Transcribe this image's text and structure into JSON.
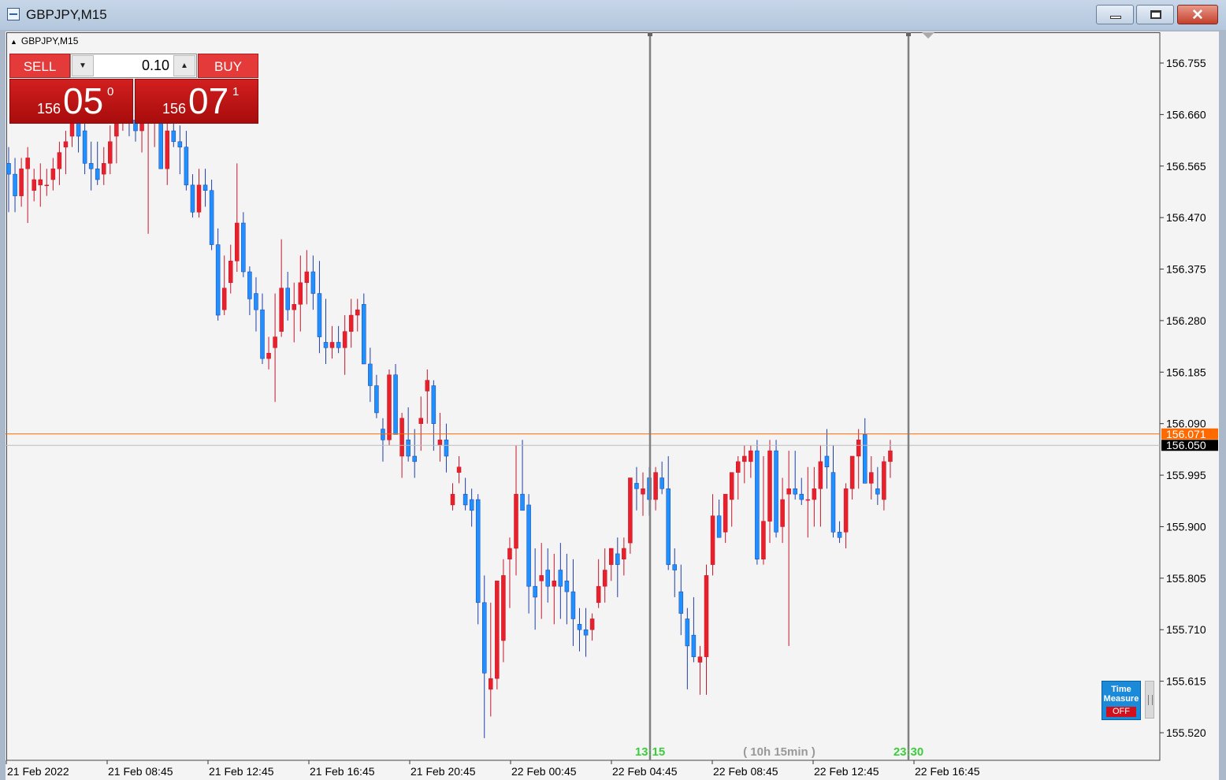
{
  "window": {
    "title": "GBPJPY,M15"
  },
  "chart": {
    "symbol_label": "GBPJPY,M15"
  },
  "trade_panel": {
    "sell_label": "SELL",
    "buy_label": "BUY",
    "lot": "0.10",
    "sell_price": {
      "prefix": "156",
      "big": "05",
      "sup": "0"
    },
    "buy_price": {
      "prefix": "156",
      "big": "07",
      "sup": "1"
    }
  },
  "time_measure": {
    "line1": "Time",
    "line2": "Measure",
    "state": "OFF"
  },
  "colors": {
    "background": "#f4f4f4",
    "bull_candle": "#e8202a",
    "bear_candle": "#1e90ff",
    "bid_line": "#ff6a00",
    "ask_line": "#bbbbbb",
    "marker_line": "#808080",
    "marker_text": "#3ccd3c"
  },
  "chart_data": {
    "type": "candlestick",
    "price_axis_ticks": [
      "156.755",
      "156.660",
      "156.565",
      "156.470",
      "156.375",
      "156.280",
      "156.185",
      "156.090",
      "155.995",
      "155.900",
      "155.805",
      "155.710",
      "155.615",
      "155.520"
    ],
    "time_axis_ticks": [
      "21 Feb 2022",
      "21 Feb 08:45",
      "21 Feb 12:45",
      "21 Feb 16:45",
      "21 Feb 20:45",
      "22 Feb 00:45",
      "22 Feb 04:45",
      "22 Feb 08:45",
      "22 Feb 12:45",
      "22 Feb 16:45"
    ],
    "bid_price": "156.050",
    "ask_price": "156.071",
    "markers": [
      {
        "label": "13:15"
      },
      {
        "label": "23:30"
      }
    ],
    "interval_label": "( 10h 15min )",
    "candles": [
      [
        156.57,
        156.6,
        156.48,
        156.55
      ],
      [
        156.55,
        156.58,
        156.48,
        156.51
      ],
      [
        156.51,
        156.58,
        156.49,
        156.56
      ],
      [
        156.56,
        156.6,
        156.46,
        156.58
      ],
      [
        156.52,
        156.56,
        156.5,
        156.54
      ],
      [
        156.53,
        156.57,
        156.49,
        156.54
      ],
      [
        156.53,
        156.56,
        156.51,
        156.53
      ],
      [
        156.54,
        156.58,
        156.52,
        156.56
      ],
      [
        156.56,
        156.61,
        156.53,
        156.59
      ],
      [
        156.6,
        156.63,
        156.55,
        156.61
      ],
      [
        156.62,
        156.7,
        156.6,
        156.66
      ],
      [
        156.66,
        156.7,
        156.59,
        156.62
      ],
      [
        156.63,
        156.66,
        156.55,
        156.57
      ],
      [
        156.57,
        156.61,
        156.52,
        156.56
      ],
      [
        156.56,
        156.61,
        156.53,
        156.54
      ],
      [
        156.55,
        156.6,
        156.53,
        156.57
      ],
      [
        156.57,
        156.64,
        156.55,
        156.61
      ],
      [
        156.62,
        156.7,
        156.57,
        156.66
      ],
      [
        156.66,
        156.71,
        156.63,
        156.68
      ],
      [
        156.67,
        156.72,
        156.62,
        156.66
      ],
      [
        156.65,
        156.71,
        156.61,
        156.63
      ],
      [
        156.63,
        156.67,
        156.59,
        156.65
      ],
      [
        156.65,
        156.71,
        156.44,
        156.66
      ],
      [
        156.66,
        156.71,
        156.6,
        156.69
      ],
      [
        156.68,
        156.72,
        156.57,
        156.56
      ],
      [
        156.56,
        156.67,
        156.53,
        156.63
      ],
      [
        156.63,
        156.67,
        156.6,
        156.61
      ],
      [
        156.61,
        156.64,
        156.55,
        156.6
      ],
      [
        156.6,
        156.63,
        156.52,
        156.53
      ],
      [
        156.53,
        156.55,
        156.47,
        156.48
      ],
      [
        156.48,
        156.56,
        156.47,
        156.53
      ],
      [
        156.53,
        156.56,
        156.49,
        156.52
      ],
      [
        156.52,
        156.54,
        156.41,
        156.42
      ],
      [
        156.42,
        156.45,
        156.28,
        156.29
      ],
      [
        156.3,
        156.4,
        156.29,
        156.34
      ],
      [
        156.35,
        156.42,
        156.33,
        156.39
      ],
      [
        156.39,
        156.57,
        156.37,
        156.46
      ],
      [
        156.46,
        156.48,
        156.36,
        156.37
      ],
      [
        156.37,
        156.38,
        156.29,
        156.32
      ],
      [
        156.33,
        156.36,
        156.26,
        156.3
      ],
      [
        156.3,
        156.33,
        156.2,
        156.21
      ],
      [
        156.21,
        156.25,
        156.19,
        156.22
      ],
      [
        156.23,
        156.33,
        156.13,
        156.25
      ],
      [
        156.26,
        156.43,
        156.25,
        156.34
      ],
      [
        156.34,
        156.37,
        156.28,
        156.3
      ],
      [
        156.3,
        156.35,
        156.24,
        156.31
      ],
      [
        156.31,
        156.4,
        156.26,
        156.35
      ],
      [
        156.35,
        156.41,
        156.31,
        156.37
      ],
      [
        156.37,
        156.4,
        156.3,
        156.33
      ],
      [
        156.33,
        156.39,
        156.22,
        156.25
      ],
      [
        156.24,
        156.32,
        156.2,
        156.23
      ],
      [
        156.23,
        156.27,
        156.21,
        156.24
      ],
      [
        156.24,
        156.27,
        156.22,
        156.23
      ],
      [
        156.23,
        156.29,
        156.18,
        156.26
      ],
      [
        156.26,
        156.32,
        156.23,
        156.29
      ],
      [
        156.29,
        156.32,
        156.26,
        156.3
      ],
      [
        156.31,
        156.33,
        156.2,
        156.2
      ],
      [
        156.2,
        156.23,
        156.13,
        156.16
      ],
      [
        156.16,
        156.18,
        156.1,
        156.11
      ],
      [
        156.08,
        156.1,
        156.02,
        156.06
      ],
      [
        156.06,
        156.19,
        156.05,
        156.18
      ],
      [
        156.18,
        156.2,
        156.07,
        156.07
      ],
      [
        156.03,
        156.11,
        155.99,
        156.1
      ],
      [
        156.06,
        156.12,
        156.02,
        156.03
      ],
      [
        156.03,
        156.08,
        155.99,
        156.02
      ],
      [
        156.09,
        156.14,
        156.04,
        156.1
      ],
      [
        156.15,
        156.19,
        156.09,
        156.17
      ],
      [
        156.16,
        156.17,
        156.04,
        156.09
      ],
      [
        156.05,
        156.11,
        156.02,
        156.06
      ],
      [
        156.06,
        156.09,
        156.0,
        156.03
      ],
      [
        155.94,
        155.98,
        155.93,
        155.96
      ],
      [
        156.0,
        156.03,
        155.98,
        156.01
      ],
      [
        155.96,
        155.99,
        155.93,
        155.94
      ],
      [
        155.95,
        155.97,
        155.9,
        155.93
      ],
      [
        155.95,
        155.96,
        155.72,
        155.76
      ],
      [
        155.76,
        155.81,
        155.51,
        155.63
      ],
      [
        155.6,
        155.76,
        155.55,
        155.62
      ],
      [
        155.62,
        155.79,
        155.6,
        155.8
      ],
      [
        155.69,
        155.84,
        155.65,
        155.81
      ],
      [
        155.84,
        155.88,
        155.75,
        155.86
      ],
      [
        155.86,
        156.05,
        155.81,
        155.96
      ],
      [
        155.96,
        156.06,
        155.94,
        155.93
      ],
      [
        155.94,
        155.96,
        155.74,
        155.79
      ],
      [
        155.79,
        155.86,
        155.71,
        155.77
      ],
      [
        155.8,
        155.87,
        155.73,
        155.81
      ],
      [
        155.82,
        155.86,
        155.76,
        155.79
      ],
      [
        155.79,
        155.85,
        155.72,
        155.8
      ],
      [
        155.82,
        155.87,
        155.73,
        155.79
      ],
      [
        155.8,
        155.85,
        155.72,
        155.78
      ],
      [
        155.78,
        155.84,
        155.68,
        155.73
      ],
      [
        155.72,
        155.75,
        155.67,
        155.71
      ],
      [
        155.71,
        155.75,
        155.66,
        155.7
      ],
      [
        155.71,
        155.74,
        155.69,
        155.73
      ],
      [
        155.76,
        155.84,
        155.75,
        155.79
      ],
      [
        155.79,
        155.86,
        155.76,
        155.82
      ],
      [
        155.83,
        155.86,
        155.8,
        155.86
      ],
      [
        155.85,
        155.88,
        155.77,
        155.83
      ],
      [
        155.84,
        155.88,
        155.81,
        155.86
      ],
      [
        155.87,
        155.99,
        155.85,
        155.99
      ],
      [
        155.98,
        156.01,
        155.93,
        155.97
      ],
      [
        155.96,
        156.0,
        155.92,
        155.97
      ],
      [
        155.99,
        156.01,
        155.92,
        155.95
      ],
      [
        155.95,
        156.01,
        155.93,
        156.0
      ],
      [
        155.99,
        156.02,
        155.96,
        155.97
      ],
      [
        155.97,
        156.03,
        155.82,
        155.83
      ],
      [
        155.83,
        155.86,
        155.77,
        155.82
      ],
      [
        155.78,
        155.83,
        155.7,
        155.74
      ],
      [
        155.73,
        155.75,
        155.6,
        155.68
      ],
      [
        155.7,
        155.77,
        155.65,
        155.66
      ],
      [
        155.65,
        155.68,
        155.59,
        155.66
      ],
      [
        155.66,
        155.83,
        155.59,
        155.81
      ],
      [
        155.83,
        155.96,
        155.81,
        155.92
      ],
      [
        155.92,
        155.95,
        155.88,
        155.88
      ],
      [
        155.89,
        155.96,
        155.87,
        155.96
      ],
      [
        155.95,
        155.99,
        155.9,
        156.0
      ],
      [
        156.0,
        156.03,
        155.95,
        156.02
      ],
      [
        156.02,
        156.05,
        155.98,
        156.03
      ],
      [
        156.02,
        156.05,
        155.99,
        156.04
      ],
      [
        156.04,
        156.06,
        155.83,
        155.84
      ],
      [
        155.84,
        156.03,
        155.83,
        155.91
      ],
      [
        155.91,
        156.06,
        155.87,
        156.04
      ],
      [
        156.04,
        156.06,
        155.88,
        155.89
      ],
      [
        155.9,
        155.99,
        155.87,
        155.95
      ],
      [
        155.96,
        156.04,
        155.68,
        155.97
      ],
      [
        155.97,
        156.04,
        155.95,
        155.96
      ],
      [
        155.96,
        155.99,
        155.94,
        155.95
      ],
      [
        155.95,
        156.01,
        155.88,
        155.95
      ],
      [
        155.95,
        156.01,
        155.9,
        155.97
      ],
      [
        155.97,
        156.05,
        155.9,
        156.02
      ],
      [
        156.03,
        156.08,
        155.97,
        156.01
      ],
      [
        156.0,
        156.05,
        155.88,
        155.89
      ],
      [
        155.89,
        155.91,
        155.87,
        155.88
      ],
      [
        155.89,
        155.98,
        155.86,
        155.97
      ],
      [
        155.97,
        156.03,
        155.95,
        156.03
      ],
      [
        156.03,
        156.08,
        155.97,
        156.06
      ],
      [
        156.07,
        156.1,
        155.98,
        155.98
      ],
      [
        155.98,
        156.03,
        155.95,
        156.0
      ],
      [
        155.97,
        156.01,
        155.94,
        155.96
      ],
      [
        155.95,
        156.03,
        155.93,
        156.02
      ],
      [
        156.02,
        156.06,
        155.99,
        156.04
      ]
    ]
  }
}
